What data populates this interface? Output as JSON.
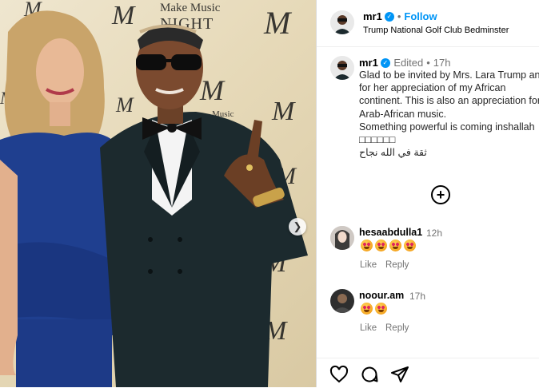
{
  "photo": {
    "backdrop_brand_top": "Make Music",
    "backdrop_brand_night": "NIGHT",
    "backdrop_small": "Music",
    "backdrop_letter": "M",
    "nav_arrow": "chevron-right-icon"
  },
  "post": {
    "username": "mr1",
    "follow_label": "Follow",
    "separator": "•",
    "location": "Trump National Golf Club Bedminster"
  },
  "caption": {
    "username": "mr1",
    "edited": "Edited",
    "time": "17h",
    "text": "Glad to be invited by Mrs. Lara Trump and for her appreciation of my African continent. This is also an appreciation for Arab-African music.\nSomething powerful is coming inshallah",
    "emoji_line": "□□□□□□",
    "arabic_line": "ثقة في الله نجاح"
  },
  "comments": [
    {
      "username": "hesaabdulla1",
      "time": "12h",
      "emoji_count": 4,
      "like_label": "Like",
      "reply_label": "Reply"
    },
    {
      "username": "noour.am",
      "time": "17h",
      "emoji_count": 2,
      "like_label": "Like",
      "reply_label": "Reply"
    }
  ],
  "colors": {
    "accent": "#0095f6",
    "muted": "#737373",
    "suit": "#1c2a2e",
    "dress": "#1f3f8f"
  }
}
